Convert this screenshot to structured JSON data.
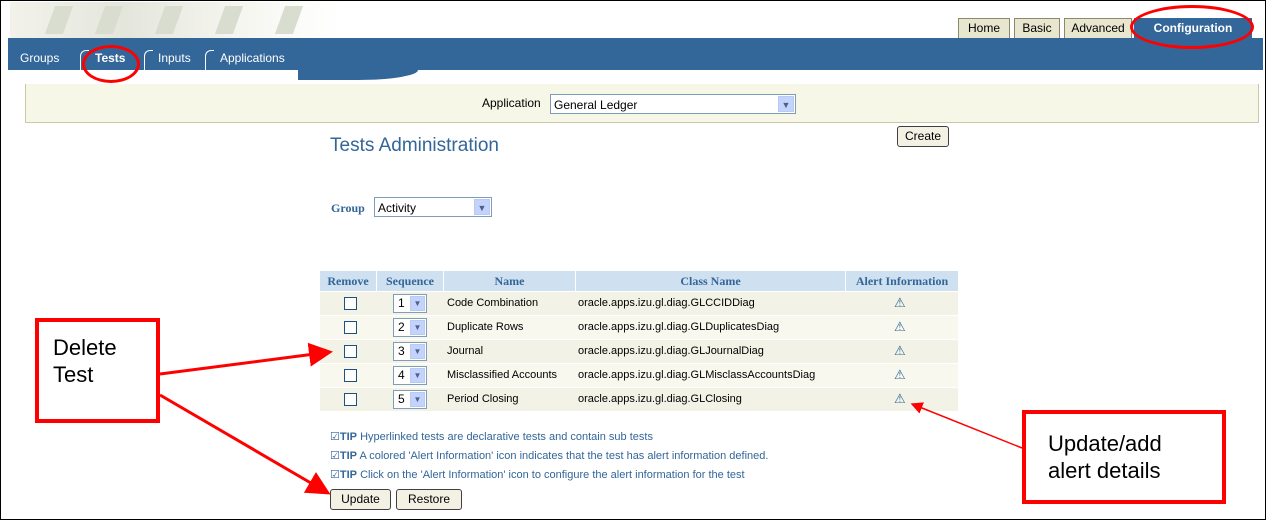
{
  "top_tabs": [
    "Home",
    "Basic",
    "Advanced",
    "Configuration"
  ],
  "sub_tabs": [
    "Groups",
    "Tests",
    "Inputs",
    "Applications"
  ],
  "application": {
    "label": "Application",
    "value": "General Ledger"
  },
  "page": {
    "title": "Tests Administration",
    "create_label": "Create"
  },
  "group": {
    "label": "Group",
    "value": "Activity"
  },
  "table": {
    "headers": [
      "Remove",
      "Sequence",
      "Name",
      "Class Name",
      "Alert Information"
    ],
    "rows": [
      {
        "seq": "1",
        "name": "Code Combination",
        "class": "oracle.apps.izu.gl.diag.GLCCIDDiag"
      },
      {
        "seq": "2",
        "name": "Duplicate Rows",
        "class": "oracle.apps.izu.gl.diag.GLDuplicatesDiag"
      },
      {
        "seq": "3",
        "name": "Journal",
        "class": "oracle.apps.izu.gl.diag.GLJournalDiag"
      },
      {
        "seq": "4",
        "name": "Misclassified Accounts",
        "class": "oracle.apps.izu.gl.diag.GLMisclassAccountsDiag"
      },
      {
        "seq": "5",
        "name": "Period Closing",
        "class": "oracle.apps.izu.gl.diag.GLClosing"
      }
    ]
  },
  "tips": [
    {
      "tag": "TIP",
      "text": "Hyperlinked tests are declarative tests and contain sub tests"
    },
    {
      "tag": "TIP",
      "text": "A colored 'Alert Information' icon indicates that the test has alert information defined."
    },
    {
      "tag": "TIP",
      "text": "Click on the 'Alert Information' icon to configure the alert information for the test"
    }
  ],
  "buttons": {
    "update": "Update",
    "restore": "Restore"
  },
  "annotations": {
    "delete_line1": "Delete",
    "delete_line2": "Test",
    "update_line1": "Update/add",
    "update_line2": "alert details"
  },
  "icons": {
    "alert": "warning-triangle-icon",
    "select_arrow": "chevron-down-icon",
    "tip": "check-icon"
  },
  "colors": {
    "accent": "#336699",
    "annotation": "#ff0000",
    "header_bg": "#cfe0f1"
  }
}
